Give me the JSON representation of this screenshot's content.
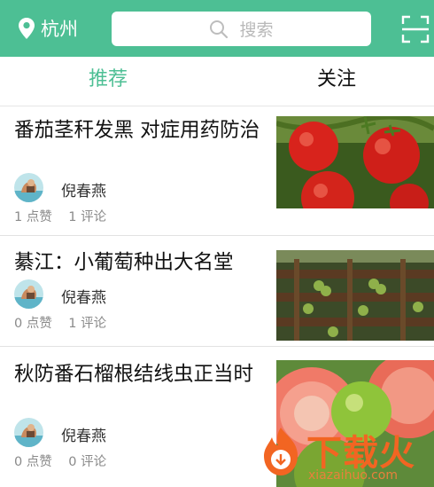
{
  "header": {
    "city": "杭州",
    "search_placeholder": "搜索",
    "accent_color": "#4dbf94"
  },
  "tabs": [
    {
      "label": "推荐",
      "active": true
    },
    {
      "label": "关注",
      "active": false
    }
  ],
  "articles": [
    {
      "title": "番茄茎秆发黑 对症用药防治",
      "author": "倪春燕",
      "likes": "1 点赞",
      "comments": "1 评论",
      "thumbnail": "tomatoes"
    },
    {
      "title": "綦江：小葡萄种出大名堂",
      "author": "倪春燕",
      "likes": "0 点赞",
      "comments": "1 评论",
      "thumbnail": "grape-trellis"
    },
    {
      "title": "秋防番石榴根结线虫正当时",
      "author": "倪春燕",
      "likes": "0 点赞",
      "comments": "0 评论",
      "thumbnail": "guava"
    }
  ],
  "watermark": {
    "brand": "下载火",
    "url": "xiazaihuo.com"
  }
}
